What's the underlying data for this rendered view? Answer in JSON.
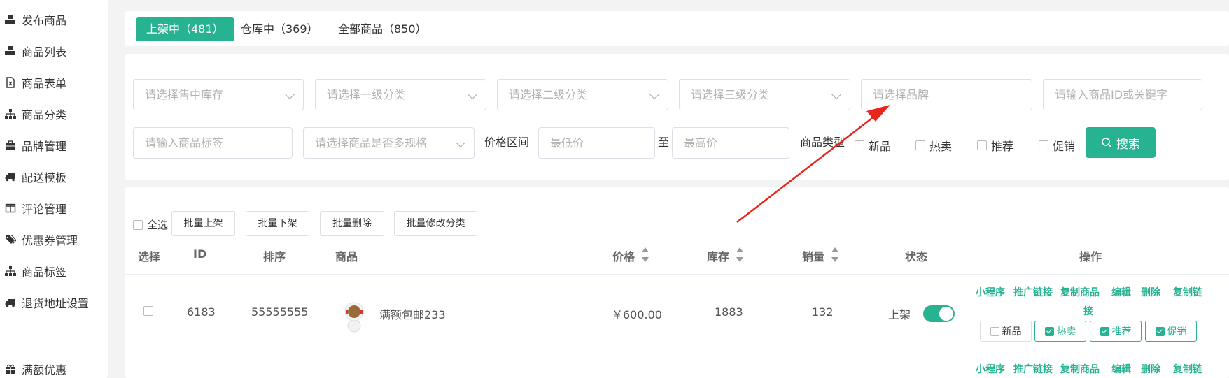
{
  "sidebar": {
    "items": [
      {
        "label": "发布商品",
        "icon": "cubes-icon"
      },
      {
        "label": "商品列表",
        "icon": "cubes-icon"
      },
      {
        "label": "商品表单",
        "icon": "file-excel-icon"
      },
      {
        "label": "商品分类",
        "icon": "sitemap-icon"
      },
      {
        "label": "品牌管理",
        "icon": "briefcase-icon"
      },
      {
        "label": "配送模板",
        "icon": "truck-icon"
      },
      {
        "label": "评论管理",
        "icon": "columns-icon"
      },
      {
        "label": "优惠券管理",
        "icon": "tags-icon"
      },
      {
        "label": "商品标签",
        "icon": "sitemap-icon"
      },
      {
        "label": "退货地址设置",
        "icon": "truck-icon"
      },
      {
        "label": "满额优惠",
        "icon": "gift-icon"
      }
    ]
  },
  "tabs": [
    {
      "label": "上架中（481）",
      "active": true
    },
    {
      "label": "仓库中（369）",
      "active": false
    },
    {
      "label": "全部商品（850）",
      "active": false
    }
  ],
  "filters": {
    "stock_select": "请选择售中库存",
    "cat1_select": "请选择一级分类",
    "cat2_select": "请选择二级分类",
    "cat3_select": "请选择三级分类",
    "brand_select": "请选择品牌",
    "keyword_input": "请输入商品ID或关键字",
    "tag_input": "请输入商品标签",
    "spec_select": "请选择商品是否多规格",
    "price_range_label": "价格区间",
    "min_price": "最低价",
    "to_label": "至",
    "max_price": "最高价",
    "type_label": "商品类型",
    "type_options": [
      "新品",
      "热卖",
      "推荐",
      "促销"
    ],
    "search_label": "搜索"
  },
  "bulk": {
    "select_all": "全选",
    "buttons": [
      "批量上架",
      "批量下架",
      "批量删除",
      "批量修改分类"
    ]
  },
  "table": {
    "headers": {
      "select": "选择",
      "id": "ID",
      "sort": "排序",
      "product": "商品",
      "price": "价格",
      "stock": "库存",
      "sales": "销量",
      "status": "状态",
      "ops": "操作"
    },
    "rows": [
      {
        "id": "6183",
        "sort": "55555555",
        "name": "满额包邮233",
        "price": "￥600.00",
        "stock": "1883",
        "sales": "132",
        "status": "上架",
        "status_on": true,
        "ops": [
          "小程序",
          "推广链接",
          "复制商品",
          "编辑",
          "删除",
          "复制链"
        ],
        "ops_wrap": "接",
        "tags": [
          {
            "label": "新品",
            "checked": false
          },
          {
            "label": "热卖",
            "checked": true
          },
          {
            "label": "推荐",
            "checked": true
          },
          {
            "label": "促销",
            "checked": true
          }
        ]
      }
    ],
    "next_row_ops": [
      "小程序",
      "推广链接",
      "复制商品",
      "编辑",
      "删除",
      "复制链"
    ]
  },
  "colors": {
    "accent": "#27b291",
    "annotation_arrow": "#e8261c"
  }
}
